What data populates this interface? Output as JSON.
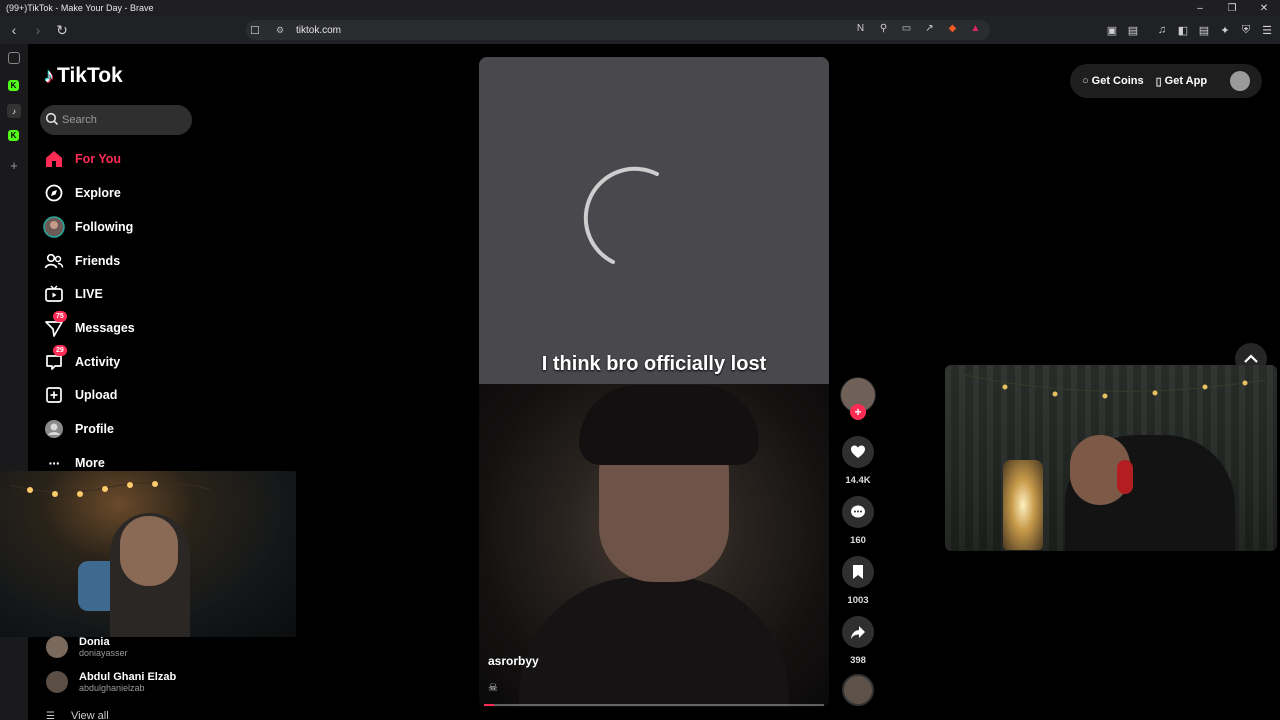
{
  "browser": {
    "window_title": "(99+)TikTok - Make Your Day - Brave",
    "url": "tiktok.com"
  },
  "tiktok": {
    "logo_text": "TikTok",
    "search_placeholder": "Search",
    "nav": [
      {
        "label": "For You",
        "icon": "home-icon",
        "active": true
      },
      {
        "label": "Explore",
        "icon": "compass-icon"
      },
      {
        "label": "Following",
        "icon": "following-avatar-icon"
      },
      {
        "label": "Friends",
        "icon": "friends-icon"
      },
      {
        "label": "LIVE",
        "icon": "live-tv-icon"
      },
      {
        "label": "Messages",
        "icon": "messages-icon",
        "badge": "75"
      },
      {
        "label": "Activity",
        "icon": "activity-icon",
        "badge": "29"
      },
      {
        "label": "Upload",
        "icon": "upload-icon"
      },
      {
        "label": "Profile",
        "icon": "profile-avatar-icon"
      },
      {
        "label": "More",
        "icon": "more-icon"
      }
    ],
    "following_accounts": [
      {
        "name": "Donia",
        "username": "doniayasser"
      },
      {
        "name": "Abdul Ghani Elzab",
        "username": "abdulghanielzab"
      }
    ],
    "view_all_label": "View all",
    "topright": {
      "get_coins": "Get Coins",
      "get_app": "Get App"
    }
  },
  "video": {
    "caption": "I think bro officially lost",
    "author": "asrorbyy",
    "progress": 0.03,
    "likes": "14.4K",
    "comments": "160",
    "saves": "1003",
    "shares": "398"
  },
  "colors": {
    "accent": "#fe2c55",
    "bg": "#000000"
  }
}
